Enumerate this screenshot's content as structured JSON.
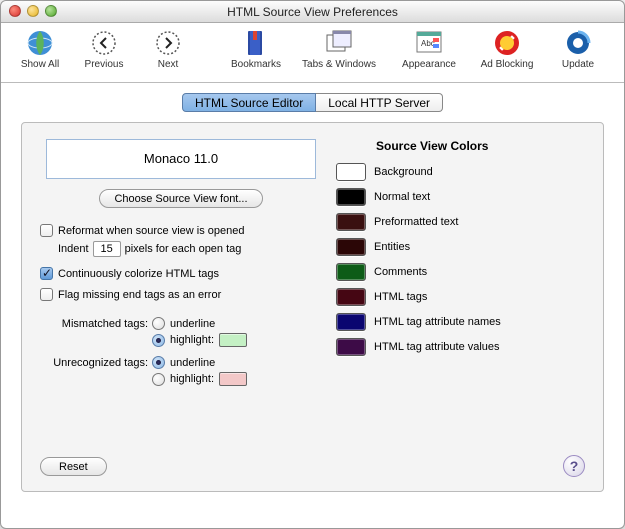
{
  "window": {
    "title": "HTML Source View Preferences"
  },
  "toolbar": {
    "show_all": "Show All",
    "previous": "Previous",
    "next": "Next",
    "bookmarks": "Bookmarks",
    "tabs_windows": "Tabs & Windows",
    "appearance": "Appearance",
    "ad_blocking": "Ad Blocking",
    "update": "Update"
  },
  "tabs": {
    "editor": "HTML Source Editor",
    "server": "Local HTTP Server"
  },
  "font": {
    "display": "Monaco  11.0",
    "choose_label": "Choose Source View font..."
  },
  "options": {
    "reformat": "Reformat when source view is opened",
    "indent_prefix": "Indent",
    "indent_value": "15",
    "indent_suffix": "pixels for each open tag",
    "colorize": "Continuously colorize HTML tags",
    "flag_missing": "Flag missing end tags as an error"
  },
  "mismatched": {
    "label": "Mismatched tags:",
    "underline": "underline",
    "highlight": "highlight:",
    "swatch": "#c4f0c4"
  },
  "unrecognized": {
    "label": "Unrecognized tags:",
    "underline": "underline",
    "highlight": "highlight:",
    "swatch": "#f3c8c8"
  },
  "colors": {
    "heading": "Source View Colors",
    "items": {
      "background": {
        "label": "Background",
        "value": "#ffffff"
      },
      "normal": {
        "label": "Normal text",
        "value": "#000000"
      },
      "preformatted": {
        "label": "Preformatted text",
        "value": "#3a1010"
      },
      "entities": {
        "label": "Entities",
        "value": "#2b0606"
      },
      "comments": {
        "label": "Comments",
        "value": "#0d5c17"
      },
      "htmltags": {
        "label": "HTML tags",
        "value": "#450613"
      },
      "attrnames": {
        "label": "HTML tag attribute names",
        "value": "#0a0570"
      },
      "attrvalues": {
        "label": "HTML tag attribute values",
        "value": "#3d0b47"
      }
    }
  },
  "buttons": {
    "reset": "Reset"
  }
}
